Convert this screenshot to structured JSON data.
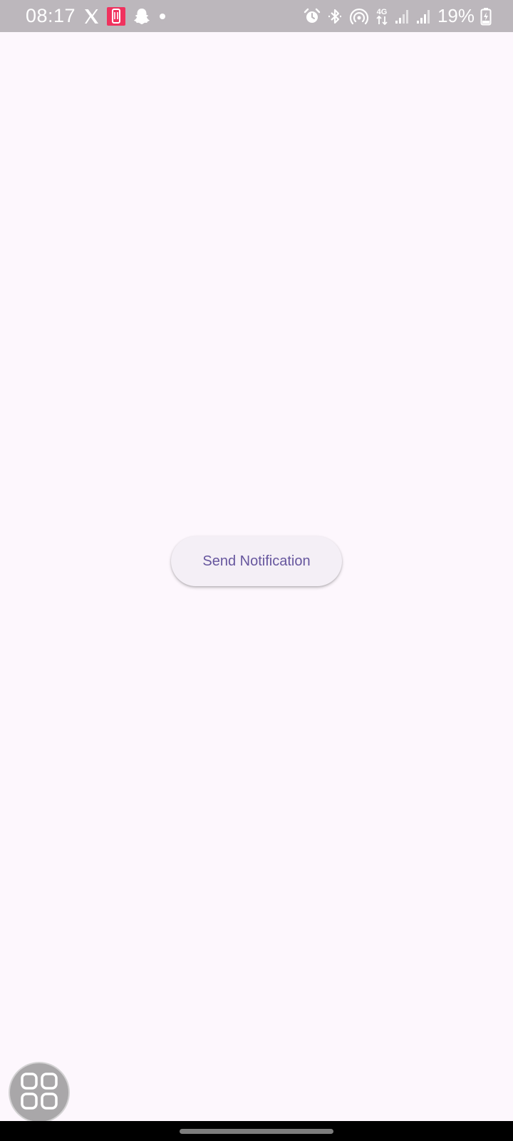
{
  "status_bar": {
    "time": "08:17",
    "battery_percent": "19%",
    "network_type": "4G",
    "icons_left": [
      "x-icon",
      "app-notification-icon",
      "snapchat-icon",
      "dot-icon"
    ],
    "icons_right": [
      "alarm-icon",
      "bluetooth-icon",
      "hotspot-icon",
      "network-4g-icon",
      "signal-icon",
      "signal-icon",
      "battery-charging-icon"
    ]
  },
  "main": {
    "send_button_label": "Send Notification"
  },
  "colors": {
    "background": "#fdf7fd",
    "status_bar": "#bcb7bc",
    "button_bg": "#f4eff6",
    "button_text": "#66569e"
  }
}
